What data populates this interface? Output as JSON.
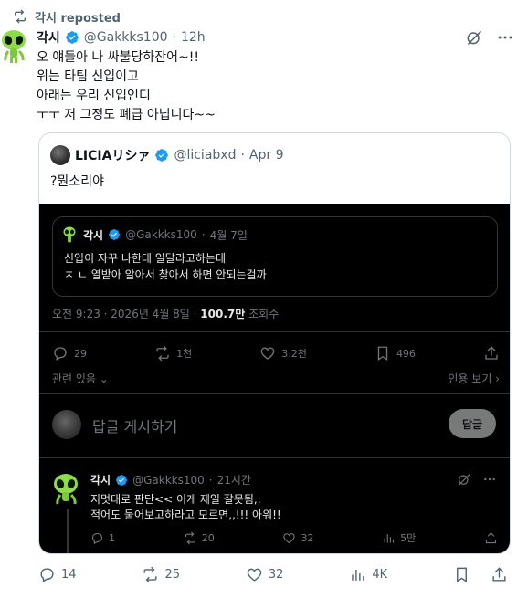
{
  "repost": {
    "label": "각시 reposted"
  },
  "tweet": {
    "author_name": "각시",
    "handle": "@Gakkks100",
    "dot": "·",
    "time": "12h",
    "lines": [
      "오 얘들아 나 싸불당하잔어~!!",
      "위는 타팀 신입이고",
      "아래는 우리 신입인디",
      "ㅜㅜ 저 그정도 폐급 아닙니다~~"
    ]
  },
  "quote": {
    "author_name": "LICIAリシァ",
    "handle": "@liciabxd",
    "dot": "·",
    "date": "Apr 9",
    "text": "?뭔소리야",
    "embedded": {
      "inner": {
        "author_name": "각시",
        "handle": "@Gakkks100",
        "dot": "·",
        "date": "4월 7일",
        "lines": [
          "신입이 자꾸 나한테 일달라고하는데",
          "ㅈ ㄴ 열받아 알아서 찾아서 하면 안되는걸까"
        ]
      },
      "meta": {
        "prefix": "오전 9:23 · 2026년 4월 8일 · ",
        "views": "100.7만",
        "views_label": " 조회수"
      },
      "stats": {
        "replies": "29",
        "reposts": "1천",
        "likes": "3.2천",
        "bookmarks": "496"
      },
      "related": "관련 있음",
      "quotes_link": "인용 보기",
      "reply_placeholder": "답글 게시하기",
      "reply_button": "답글",
      "reply": {
        "author_name": "각시",
        "handle": "@Gakkks100",
        "dot": "·",
        "time": "21시간",
        "lines": [
          "지멋대로 판단<< 이게 제일 잘못됨,,",
          "적어도 물어보고하라고 모르면,,!!! 아워!!"
        ],
        "stats": {
          "replies": "1",
          "reposts": "20",
          "likes": "32",
          "views": "5만"
        }
      }
    }
  },
  "actions": {
    "replies": "14",
    "reposts": "25",
    "likes": "32",
    "views": "4K"
  },
  "colors": {
    "verified": "#1d9bf0",
    "text": "#0f1419",
    "muted": "#536471",
    "dark_bg": "#000000"
  }
}
